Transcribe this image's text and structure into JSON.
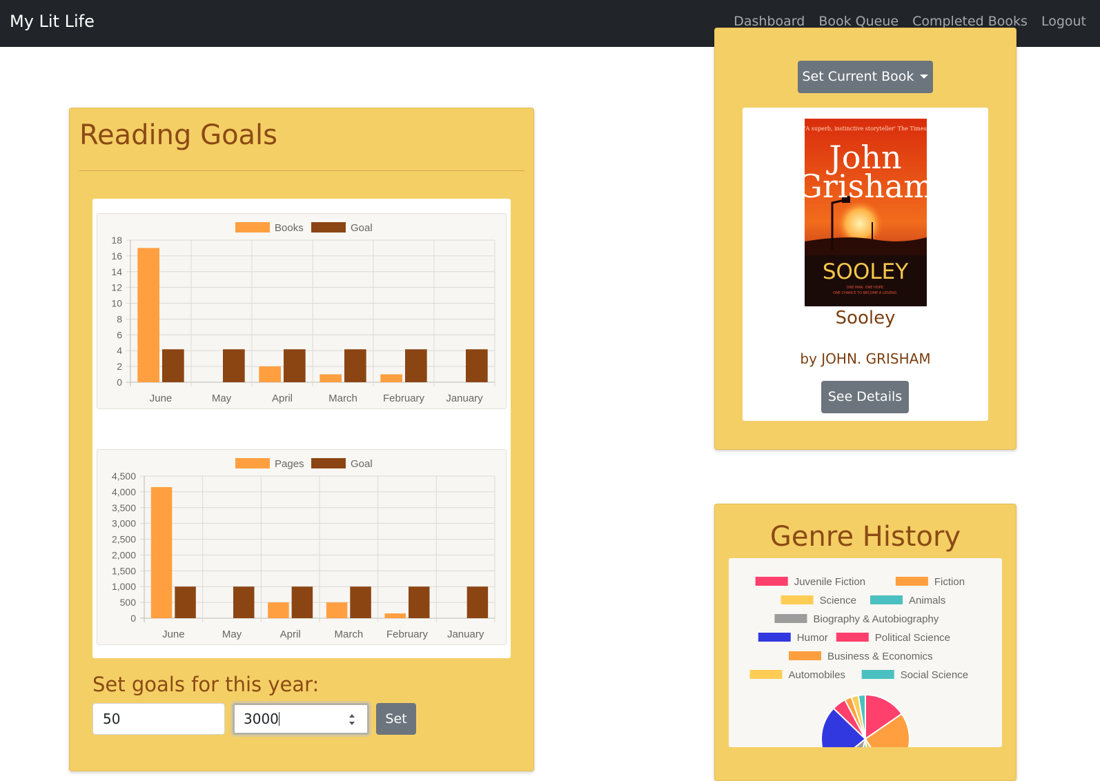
{
  "navbar": {
    "brand": "My Lit Life",
    "links": [
      "Dashboard",
      "Book Queue",
      "Completed Books",
      "Logout"
    ]
  },
  "reading_goals": {
    "title": "Reading Goals",
    "set_goals_label": "Set goals for this year:",
    "books_goal_value": "50",
    "pages_goal_value": "3000",
    "set_button": "Set"
  },
  "current_book": {
    "set_button": "Set Current Book",
    "cover": {
      "quote": "'A superb, instinctive storyteller' The Times",
      "author_first": "John",
      "author_last": "Grisham",
      "title": "SOOLEY",
      "tagline_1": "ONE MAN. ONE HOPE.",
      "tagline_2": "ONE CHANCE TO BECOME A LEGEND."
    },
    "title": "Sooley",
    "author": "by JOHN. GRISHAM",
    "details_button": "See Details"
  },
  "genre_history": {
    "title": "Genre History"
  },
  "colors": {
    "navbar": "#212529",
    "card": "#f4cf65",
    "heading": "#8b4a14",
    "series_actual": "#ff9f40",
    "series_goal": "#8b4513",
    "button": "#6c757d"
  },
  "chart_data": [
    {
      "type": "bar",
      "categories": [
        "June",
        "May",
        "April",
        "March",
        "February",
        "January"
      ],
      "series": [
        {
          "name": "Books",
          "color": "#ff9f40",
          "values": [
            17,
            0,
            2,
            1,
            1,
            0
          ]
        },
        {
          "name": "Goal",
          "color": "#8b4513",
          "values": [
            4.17,
            4.17,
            4.17,
            4.17,
            4.17,
            4.17
          ]
        }
      ],
      "y_ticks": [
        "0",
        "2",
        "4",
        "6",
        "8",
        "10",
        "12",
        "14",
        "16",
        "18"
      ],
      "ylim": [
        0,
        18
      ],
      "grid": true,
      "legend": "top"
    },
    {
      "type": "bar",
      "categories": [
        "June",
        "May",
        "April",
        "March",
        "February",
        "January"
      ],
      "series": [
        {
          "name": "Pages",
          "color": "#ff9f40",
          "values": [
            4150,
            0,
            500,
            500,
            150,
            0
          ]
        },
        {
          "name": "Goal",
          "color": "#8b4513",
          "values": [
            1000,
            1000,
            1000,
            1000,
            1000,
            1000
          ]
        }
      ],
      "y_ticks": [
        "0",
        "500",
        "1,000",
        "1,500",
        "2,000",
        "2,500",
        "3,000",
        "3,500",
        "4,000",
        "4,500"
      ],
      "ylim": [
        0,
        4500
      ],
      "grid": true,
      "legend": "top"
    },
    {
      "type": "pie",
      "categories": [
        "Juvenile Fiction",
        "Fiction",
        "Science",
        "Animals",
        "Biography & Autobiography",
        "Humor",
        "Political Science",
        "Business & Economics",
        "Automobiles",
        "Social Science"
      ],
      "series": [
        {
          "name": "",
          "values": [
            6,
            10,
            3,
            2,
            4,
            9,
            2,
            1,
            1,
            1
          ],
          "colors": [
            "#ff3f6c",
            "#ff9f40",
            "#ffcd56",
            "#4bc0c0",
            "#9c9c9c",
            "#3238e0",
            "#ff3f6c",
            "#ff9f40",
            "#ffcd56",
            "#4bc0c0"
          ]
        }
      ],
      "legend": "top"
    }
  ]
}
